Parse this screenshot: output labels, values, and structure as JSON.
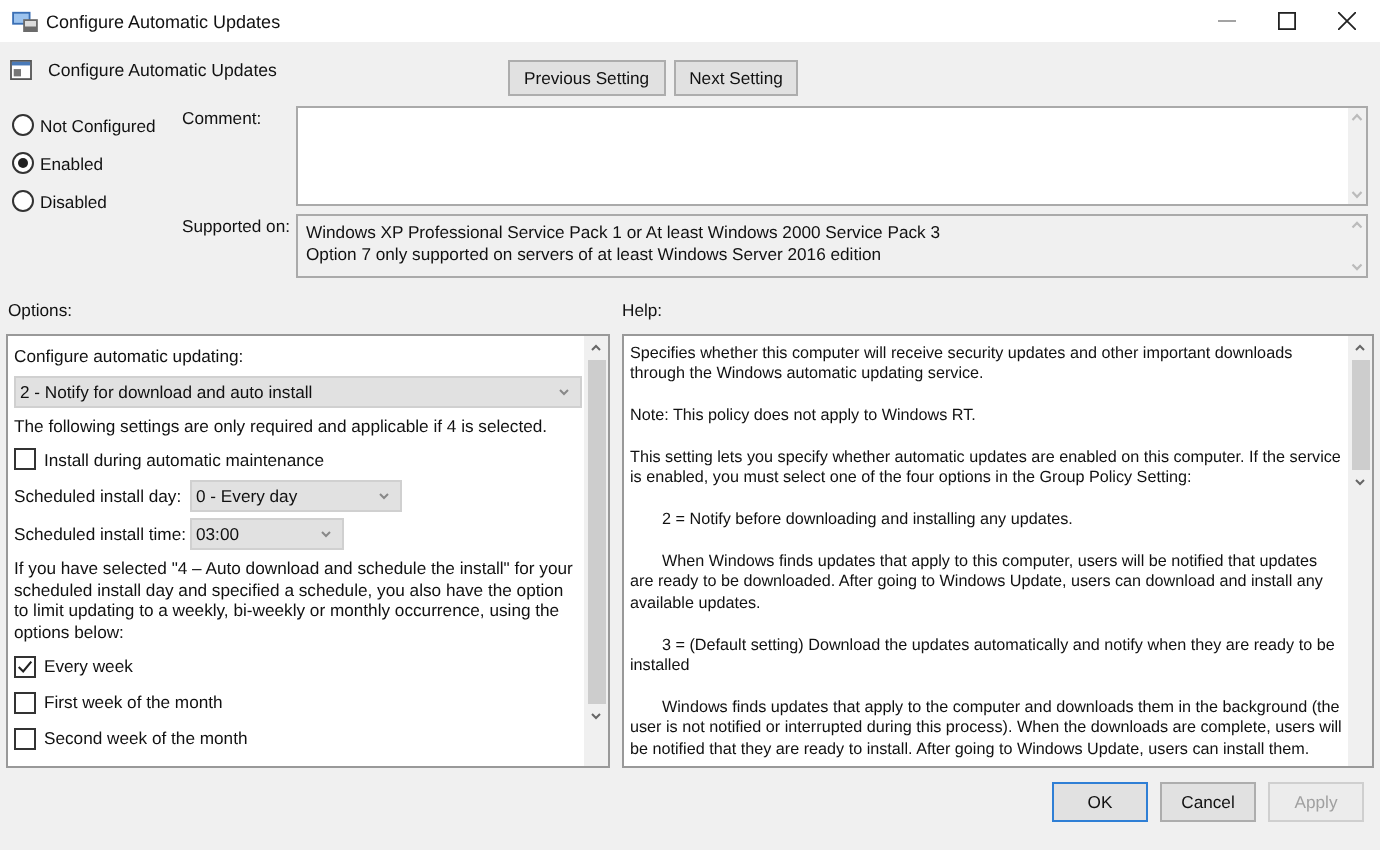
{
  "window": {
    "title": "Configure Automatic Updates"
  },
  "header": {
    "title": "Configure Automatic Updates",
    "buttons": [
      "Previous Setting",
      "Next Setting"
    ]
  },
  "state_options": [
    {
      "label": "Not Configured",
      "selected": false
    },
    {
      "label": "Enabled",
      "selected": true
    },
    {
      "label": "Disabled",
      "selected": false
    }
  ],
  "comment": {
    "label": "Comment:"
  },
  "supported_on": {
    "label": "Supported on:",
    "lines": [
      "Windows XP Professional Service Pack 1 or At least Windows 2000 Service Pack 3",
      "Option 7 only supported on servers of at least Windows Server 2016 edition"
    ]
  },
  "options": {
    "label": "Options:",
    "items": [
      {
        "kind": "text",
        "text": "Configure automatic updating:"
      },
      {
        "kind": "dropdown",
        "value": "2 - Notify for download and auto install"
      },
      {
        "kind": "text",
        "text": "The following settings are only required and applicable if 4 is selected."
      },
      {
        "kind": "checkbox",
        "label": "Install during automatic maintenance",
        "checked": false
      },
      {
        "kind": "labeled_dropdown",
        "label": "Scheduled install day:",
        "value": "0 - Every day"
      },
      {
        "kind": "labeled_dropdown",
        "label": "Scheduled install time:",
        "value": "03:00"
      },
      {
        "kind": "text",
        "text": "If you have selected \"4 – Auto download and schedule the install\" for your scheduled install day and specified a schedule, you also have the option to limit updating to a weekly, bi-weekly or monthly occurrence, using the options below:"
      },
      {
        "kind": "checkbox",
        "label": "Every week",
        "checked": true
      },
      {
        "kind": "checkbox",
        "label": "First week of the month",
        "checked": false
      },
      {
        "kind": "checkbox",
        "label": "Second week of the month",
        "checked": false
      }
    ]
  },
  "help": {
    "label": "Help:",
    "paragraphs": [
      {
        "text": "Specifies whether this computer will receive security updates and other important downloads through the Windows automatic updating service.",
        "indented": false
      },
      {
        "text": "Note: This policy does not apply to Windows RT.",
        "indented": false
      },
      {
        "text": "This setting lets you specify whether automatic updates are enabled on this computer. If the service is enabled, you must select one of the four options in the Group Policy Setting:",
        "indented": false
      },
      {
        "text": "2 = Notify before downloading and installing any updates.",
        "indented": true
      },
      {
        "text": "When Windows finds updates that apply to this computer, users will be notified that updates are ready to be downloaded. After going to Windows Update, users can download and install any available updates.",
        "indented": true
      },
      {
        "text": "3 = (Default setting) Download the updates automatically and notify when they are ready to be installed",
        "indented": true
      },
      {
        "text": "Windows finds updates that apply to the computer and downloads them in the background (the user is not notified or interrupted during this process). When the downloads are complete, users will be notified that they are ready to install. After going to Windows Update, users can install them.",
        "indented": true
      }
    ]
  },
  "footer_buttons": [
    {
      "label": "OK",
      "kind": "default",
      "disabled": false
    },
    {
      "label": "Cancel",
      "kind": "normal",
      "disabled": false
    },
    {
      "label": "Apply",
      "kind": "normal",
      "disabled": true
    }
  ]
}
